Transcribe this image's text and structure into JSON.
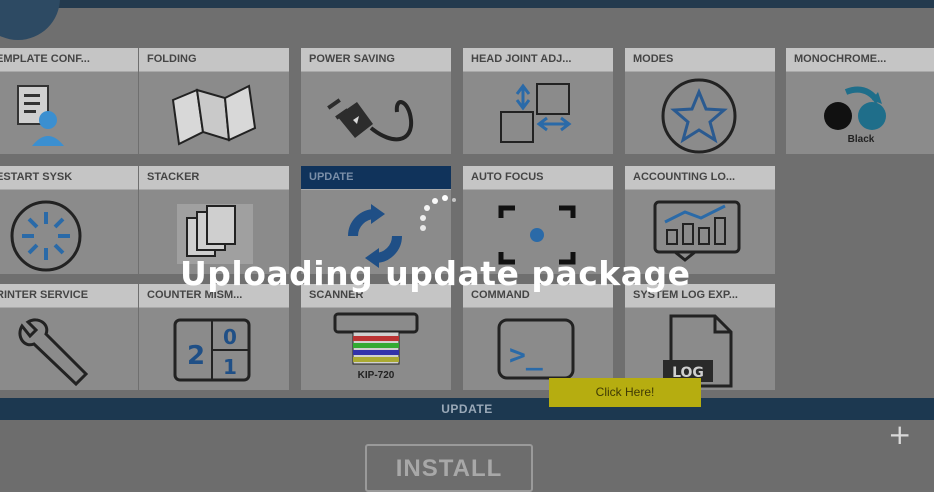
{
  "app": {
    "back_icon": "back-arrow-icon"
  },
  "tiles": [
    {
      "label": "EMPLATE CONF...",
      "icon": "template-config-icon"
    },
    {
      "label": "FOLDING",
      "icon": "folding-icon"
    },
    {
      "label": "POWER SAVING",
      "icon": "power-plug-icon"
    },
    {
      "label": "HEAD JOINT ADJ...",
      "icon": "head-joint-icon"
    },
    {
      "label": "MODES",
      "icon": "star-icon"
    },
    {
      "label": "MONOCHROME...",
      "icon": "monochrome-icon",
      "sublabel": "Black"
    },
    {
      "label": "ESTART SYSK",
      "icon": "restart-icon"
    },
    {
      "label": "STACKER",
      "icon": "stacker-icon"
    },
    {
      "label": "UPDATE",
      "icon": "refresh-icon",
      "selected": true
    },
    {
      "label": "AUTO FOCUS",
      "icon": "focus-icon"
    },
    {
      "label": "ACCOUNTING LO...",
      "icon": "chart-icon"
    },
    {
      "label": "RINTER SERVICE",
      "icon": "wrench-icon"
    },
    {
      "label": "COUNTER MISM...",
      "icon": "counter-icon",
      "digits": [
        "2",
        "0",
        "1"
      ]
    },
    {
      "label": "SCANNER",
      "icon": "scanner-icon",
      "sublabel": "KIP-720"
    },
    {
      "label": "COMMAND",
      "icon": "terminal-icon",
      "prompt": ">_"
    },
    {
      "label": "SYSTEM LOG EXP...",
      "icon": "log-file-icon",
      "badge": "LOG"
    }
  ],
  "update_panel": {
    "title": "UPDATE",
    "install_label": "INSTALL",
    "add_icon": "plus-icon"
  },
  "overlay": {
    "message": "Uploading update package",
    "spinner_icon": "loading-spinner-icon"
  },
  "tooltip_button": {
    "label": "Click Here!",
    "color": "#b6ad10"
  },
  "colors": {
    "header_bar": "#1c3850",
    "selected_tile": "#10335b",
    "overlay_text": "#ffffff"
  }
}
